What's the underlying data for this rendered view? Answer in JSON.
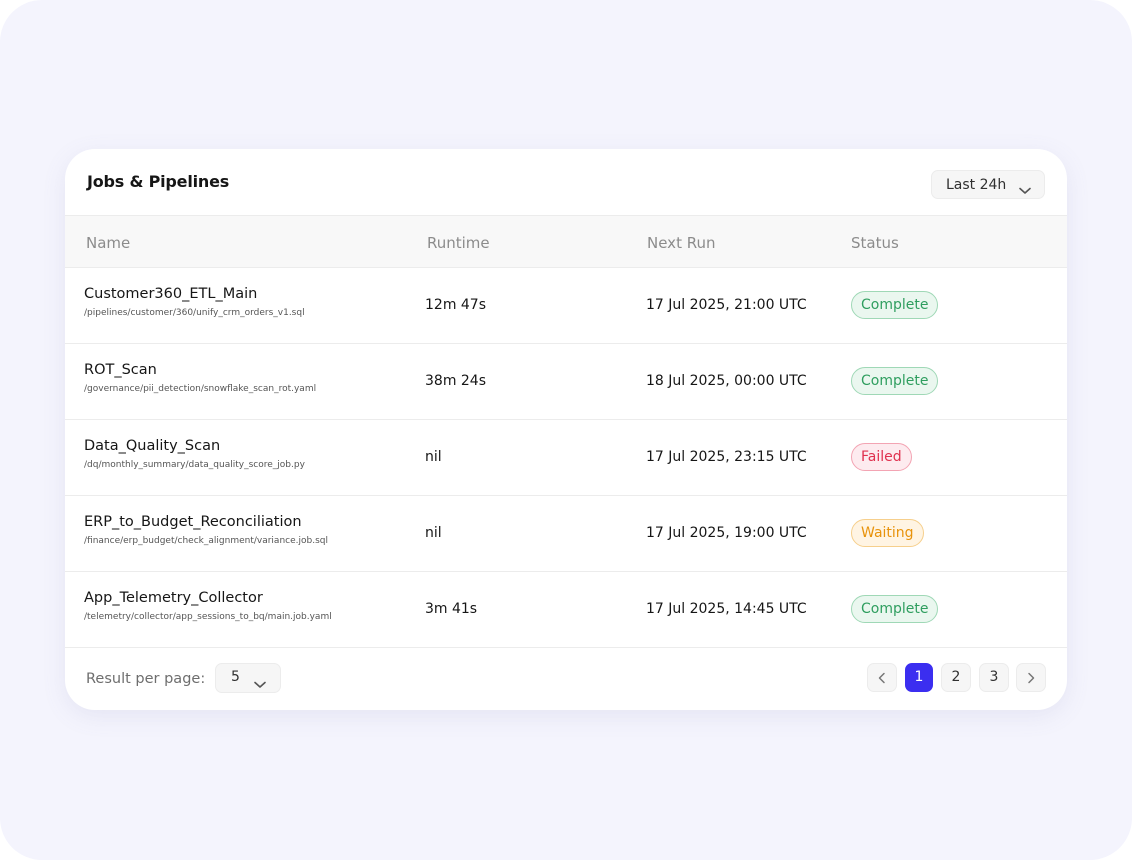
{
  "card": {
    "title": "Jobs & Pipelines",
    "range_filter": {
      "value": "Last 24h",
      "icon": "chevron-down-icon"
    }
  },
  "table": {
    "columns": [
      "Name",
      "Runtime",
      "Next Run",
      "Status"
    ],
    "rows": [
      {
        "name": "Customer360_ETL_Main",
        "path": "/pipelines/customer/360/unify_crm_orders_v1.sql",
        "runtime": "12m 47s",
        "next_run": "17 Jul 2025, 21:00 UTC",
        "status": "Complete"
      },
      {
        "name": "ROT_Scan",
        "path": "/governance/pii_detection/snowflake_scan_rot.yaml",
        "runtime": "38m 24s",
        "next_run": "18 Jul 2025, 00:00 UTC",
        "status": "Complete"
      },
      {
        "name": "Data_Quality_Scan",
        "path": "/dq/monthly_summary/data_quality_score_job.py",
        "runtime": "nil",
        "next_run": "17 Jul 2025, 23:15 UTC",
        "status": "Failed"
      },
      {
        "name": "ERP_to_Budget_Reconciliation",
        "path": "/finance/erp_budget/check_alignment/variance.job.sql",
        "runtime": "nil",
        "next_run": "17 Jul 2025, 19:00 UTC",
        "status": "Waiting"
      },
      {
        "name": "App_Telemetry_Collector",
        "path": "/telemetry/collector/app_sessions_to_bq/main.job.yaml",
        "runtime": "3m 41s",
        "next_run": "17 Jul 2025, 14:45 UTC",
        "status": "Complete"
      }
    ]
  },
  "status_colors": {
    "Complete": {
      "text": "#2f9e5f",
      "bg": "#eaf7ef",
      "border": "#9fd8b6"
    },
    "Failed": {
      "text": "#e0304e",
      "bg": "#fdebef",
      "border": "#f3a4b3"
    },
    "Waiting": {
      "text": "#e8930c",
      "bg": "#fff4e3",
      "border": "#f6cf8c"
    }
  },
  "footer": {
    "results_label": "Result per page:",
    "results_value": "5",
    "pages": [
      "1",
      "2",
      "3"
    ],
    "current_page": "1",
    "prev_icon": "chevron-left-icon",
    "next_icon": "chevron-right-icon"
  },
  "colors": {
    "accent": "#3b2ef0",
    "page_background": "#f4f4fd",
    "card_background": "#ffffff"
  }
}
